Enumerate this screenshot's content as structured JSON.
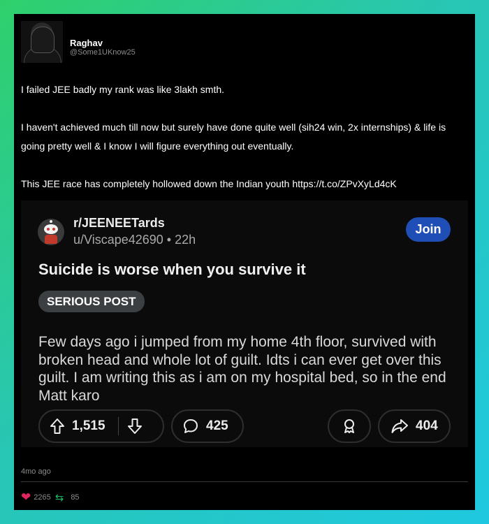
{
  "tweet": {
    "name": "Raghav",
    "handle": "@Some1UKnow25",
    "paragraphs": [
      "I failed JEE badly my rank was like 3lakh smth.",
      "I haven't achieved much till now but surely have done quite well (sih24 win, 2x internships) & life is going pretty well & I know I will figure everything out eventually.",
      "This JEE race has completely hollowed down the Indian youth https://t.co/ZPvXyLd4cK"
    ],
    "time_ago": "4mo ago",
    "likes": "2265",
    "retweets": "85"
  },
  "reddit_post": {
    "subreddit": "r/JEENEETards",
    "user": "u/Viscape42690",
    "age": "22h",
    "join_label": "Join",
    "title": "Suicide is worse when you survive it",
    "flair": "SERIOUS POST",
    "body": "Few days ago i jumped from my home 4th floor, survived with broken head and whole lot of guilt. Idts i can ever get over this guilt. I am writing this as i am on my hospital bed, so in the end Matt karo",
    "votes": "1,515",
    "comments": "425",
    "shares": "404"
  },
  "colors": {
    "background_gradient_start": "#2fd06b",
    "background_gradient_end": "#1fc8e0",
    "card": "#000000",
    "join_button": "#1f4fb6",
    "like_heart": "#e0245e",
    "retweet": "#17bf63"
  },
  "icons": [
    "profile-avatar",
    "subreddit-avatar",
    "upvote-icon",
    "downvote-icon",
    "comment-icon",
    "award-icon",
    "share-icon",
    "heart-icon",
    "retweet-icon"
  ]
}
